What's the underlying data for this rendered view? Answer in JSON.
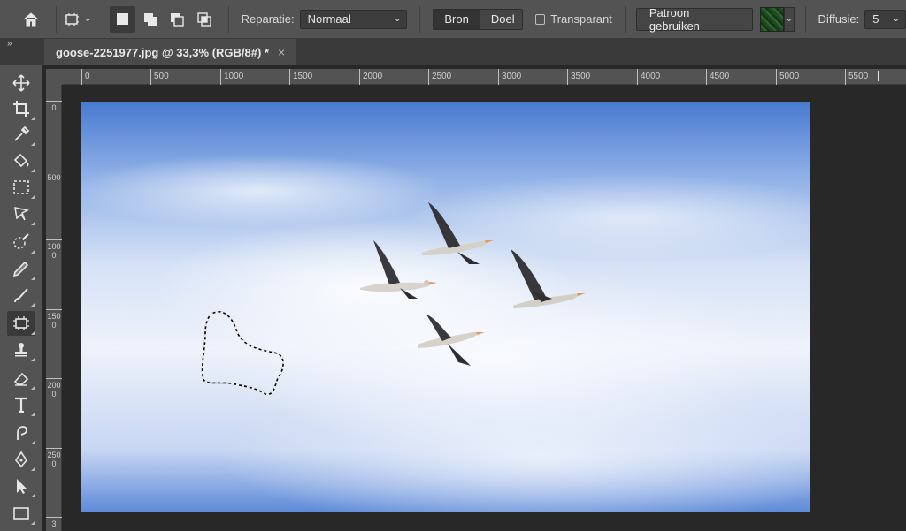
{
  "options_bar": {
    "reparatie_label": "Reparatie:",
    "reparatie_value": "Normaal",
    "bron_label": "Bron",
    "doel_label": "Doel",
    "transparant_label": "Transparant",
    "patroon_button": "Patroon gebruiken",
    "diffusie_label": "Diffusie:",
    "diffusie_value": "5"
  },
  "document_tab": {
    "title": "goose-2251977.jpg @ 33,3% (RGB/8#) *",
    "close": "×"
  },
  "panel_collapse": "»",
  "ruler": {
    "horizontal": [
      "0",
      "500",
      "1000",
      "1500",
      "2000",
      "2500",
      "3000",
      "3500",
      "4000",
      "4500",
      "5000",
      "5500"
    ],
    "vertical": [
      "0",
      "500",
      "1000",
      "1500",
      "2000",
      "2500",
      "3"
    ]
  },
  "tools": [
    "move-tool",
    "crop-tool",
    "eyedropper-tool",
    "paint-bucket-tool",
    "marquee-tool",
    "lasso-tool",
    "quick-selection-tool",
    "healing-brush-tool",
    "brush-tool",
    "patch-tool",
    "clone-stamp-tool",
    "eraser-tool",
    "type-tool",
    "smudge-tool",
    "pen-tool",
    "path-selection-tool",
    "rectangle-tool"
  ],
  "active_tool": "patch-tool",
  "colors": {
    "sky_top": "#4a7ad0",
    "cloud": "#eef2fb",
    "ui_panel": "#535353",
    "ui_dark": "#282828"
  }
}
